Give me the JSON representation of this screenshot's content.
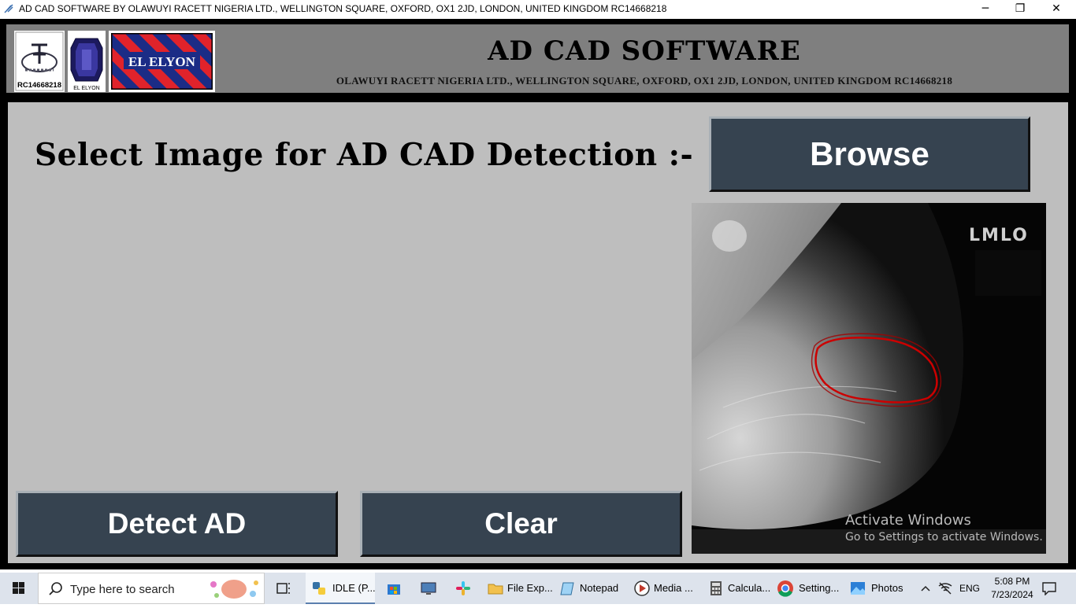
{
  "window": {
    "title": "AD CAD SOFTWARE BY OLAWUYI RACETT NIGERIA LTD., WELLINGTON SQUARE, OXFORD, OX1 2JD, LONDON, UNITED KINGDOM RC14668218",
    "minimize": "─",
    "restore": "❐",
    "close": "✕"
  },
  "header": {
    "logo1_caption": "RC14668218",
    "logo2_caption": "EL ELYON",
    "logo3_text": "EL ELYON",
    "title": "AD CAD SOFTWARE",
    "subtitle": "OLAWUYI RACETT NIGERIA LTD., WELLINGTON SQUARE, OXFORD, OX1 2JD, LONDON, UNITED KINGDOM RC14668218"
  },
  "main": {
    "prompt": "Select Image for AD CAD Detection :-",
    "browse_label": "Browse",
    "detect_label": "Detect AD",
    "clear_label": "Clear",
    "image_label": "LMLO"
  },
  "watermark": {
    "line1": "Activate Windows",
    "line2": "Go to Settings to activate Windows."
  },
  "taskbar": {
    "search_placeholder": "Type here to search",
    "items": [
      {
        "label": "IDLE (P...",
        "icon": "python-icon"
      },
      {
        "label": "",
        "icon": "store-icon"
      },
      {
        "label": "",
        "icon": "network-monitor-icon"
      },
      {
        "label": "",
        "icon": "slack-icon"
      },
      {
        "label": "File Exp...",
        "icon": "folder-icon"
      },
      {
        "label": "Notepad",
        "icon": "notepad-icon"
      },
      {
        "label": "Media ...",
        "icon": "media-player-icon"
      },
      {
        "label": "Calcula...",
        "icon": "calculator-icon"
      },
      {
        "label": "Setting...",
        "icon": "chrome-icon"
      },
      {
        "label": "Photos",
        "icon": "photos-icon"
      }
    ],
    "language": "ENG",
    "time": "5:08 PM",
    "date": "7/23/2024"
  },
  "colors": {
    "button_bg": "#364350",
    "panel_bg": "#bebebe",
    "header_bg": "#7f7f7f",
    "contour": "#cc0000"
  }
}
